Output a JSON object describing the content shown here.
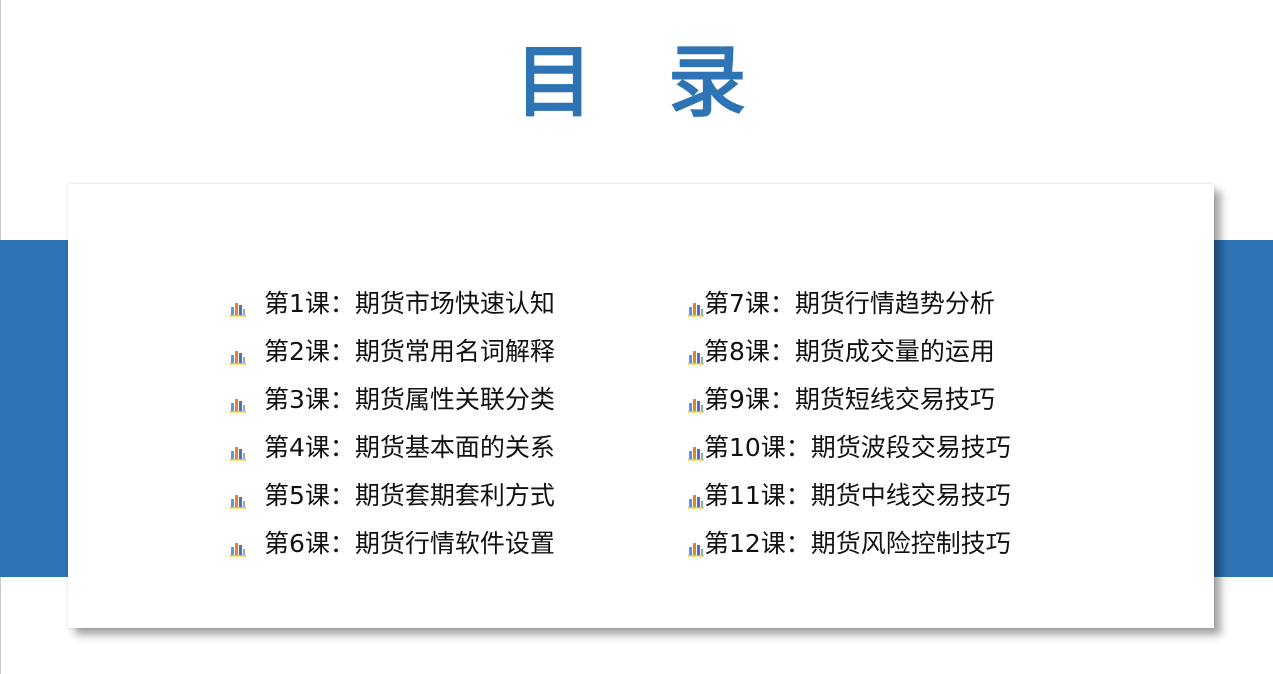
{
  "page": {
    "title": "目 录",
    "accent_color": "#2e74b5"
  },
  "toc": {
    "bullet_icon": "bar-chart-icon",
    "left_items": [
      {
        "label": "第1课：期货市场快速认知"
      },
      {
        "label": "第2课：期货常用名词解释"
      },
      {
        "label": "第3课：期货属性关联分类"
      },
      {
        "label": "第4课：期货基本面的关系"
      },
      {
        "label": "第5课：期货套期套利方式"
      },
      {
        "label": "第6课：期货行情软件设置"
      }
    ],
    "right_items": [
      {
        "label": "第7课：期货行情趋势分析"
      },
      {
        "label": "第8课：期货成交量的运用"
      },
      {
        "label": "第9课：期货短线交易技巧"
      },
      {
        "label": "第10课：期货波段交易技巧"
      },
      {
        "label": "第11课：期货中线交易技巧"
      },
      {
        "label": "第12课：期货风险控制技巧"
      }
    ]
  }
}
